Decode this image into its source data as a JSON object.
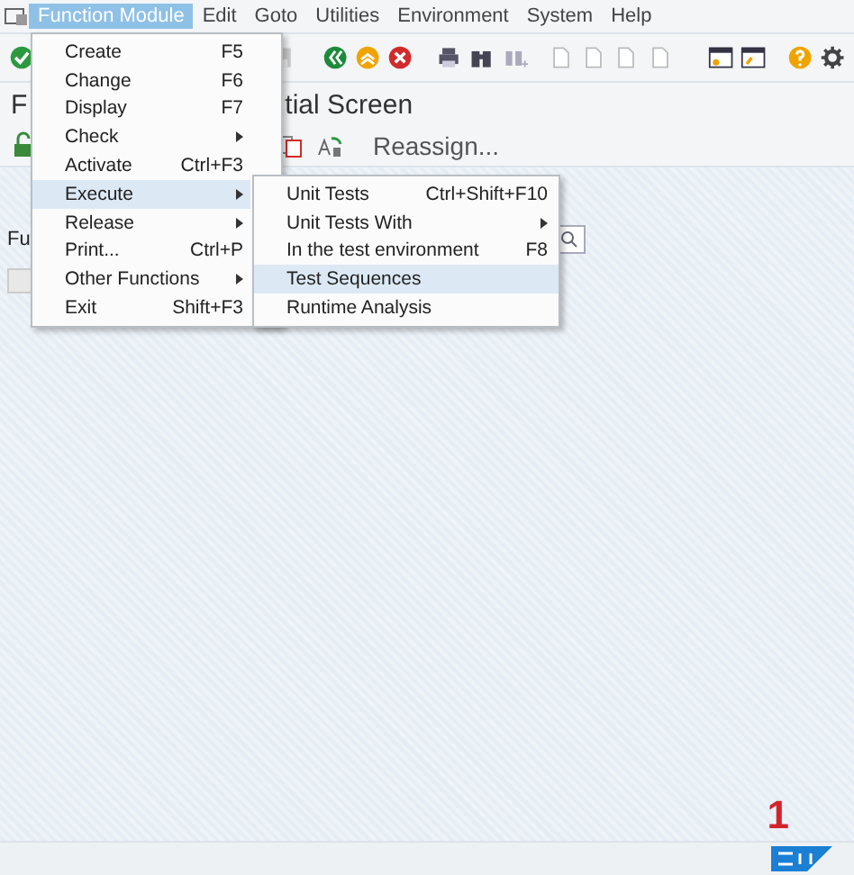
{
  "menu_bar": [
    {
      "label": "Function Module",
      "selected": true
    },
    {
      "label": "Edit",
      "selected": false
    },
    {
      "label": "Goto",
      "selected": false
    },
    {
      "label": "Utilities",
      "selected": false
    },
    {
      "label": "Environment",
      "selected": false
    },
    {
      "label": "System",
      "selected": false
    },
    {
      "label": "Help",
      "selected": false
    }
  ],
  "title_parts": [
    "F",
    "tial Screen"
  ],
  "app_toolbar": {
    "button": "Reassign..."
  },
  "field_label": "Fu",
  "menu": [
    {
      "label": "Create",
      "shortcut": "F5",
      "submenu": false,
      "selected": false
    },
    {
      "label": "Change",
      "shortcut": "F6",
      "submenu": false,
      "selected": false
    },
    {
      "label": "Display",
      "shortcut": "F7",
      "submenu": false,
      "selected": false
    },
    {
      "label": "Check",
      "submenu": true,
      "selected": false
    },
    {
      "label": "Activate",
      "shortcut": "Ctrl+F3",
      "submenu": false,
      "selected": false
    },
    {
      "label": "Execute",
      "submenu": true,
      "selected": true
    },
    {
      "label": "Release",
      "submenu": true,
      "selected": false
    },
    {
      "label": "Print...",
      "shortcut": "Ctrl+P",
      "submenu": false,
      "selected": false
    },
    {
      "label": "Other Functions",
      "submenu": true,
      "selected": false
    },
    {
      "label": "Exit",
      "shortcut": "Shift+F3",
      "submenu": false,
      "selected": false
    }
  ],
  "submenu": [
    {
      "label": "Unit Tests",
      "shortcut": "Ctrl+Shift+F10",
      "submenu": false,
      "selected": false
    },
    {
      "label": "Unit Tests With",
      "submenu": true,
      "selected": false
    },
    {
      "label": "In the test environment",
      "shortcut": "F8",
      "submenu": false,
      "selected": false
    },
    {
      "label": "Test Sequences",
      "submenu": false,
      "selected": true
    },
    {
      "label": "Runtime Analysis",
      "submenu": false,
      "selected": false
    }
  ],
  "step_number": "1"
}
